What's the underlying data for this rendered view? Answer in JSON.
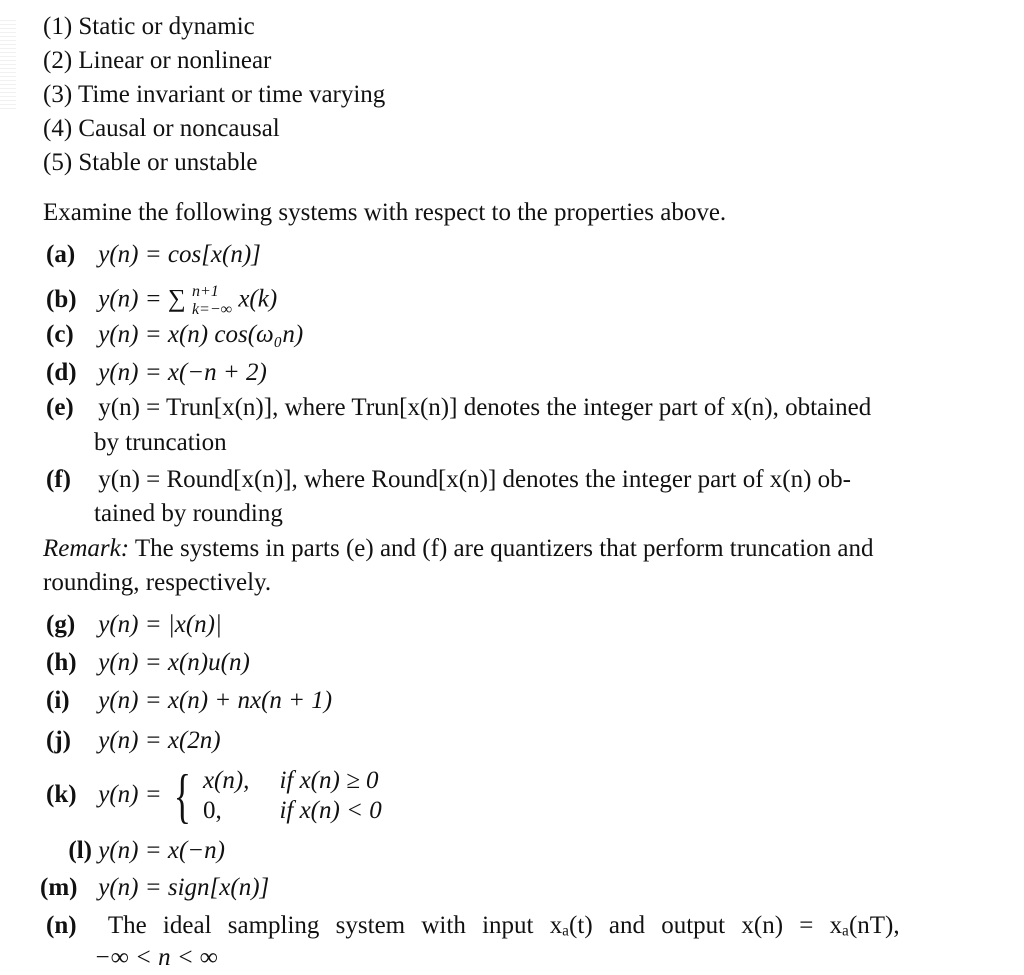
{
  "properties": [
    "(1) Static or dynamic",
    "(2) Linear or nonlinear",
    "(3) Time invariant or time varying",
    "(4) Causal or noncausal",
    "(5) Stable or unstable"
  ],
  "intro": "Examine the following systems with respect to the properties above.",
  "items": {
    "a": {
      "label": "(a)",
      "expr": "y(n) = cos[x(n)]"
    },
    "b": {
      "label": "(b)",
      "lhs": "y(n) = ",
      "sum": "∑",
      "upper": "n+1",
      "lower": "k=−∞",
      "rhs": " x(k)"
    },
    "c": {
      "label": "(c)",
      "expr": "y(n) = x(n) cos(ω₀n)"
    },
    "d": {
      "label": "(d)",
      "expr": "y(n) = x(−n + 2)"
    },
    "e": {
      "label": "(e)",
      "line1": "y(n) = Trun[x(n)], where Trun[x(n)] denotes the integer part of x(n), obtained",
      "line2": "by truncation"
    },
    "f": {
      "label": "(f)",
      "line1": "y(n) = Round[x(n)], where Round[x(n)] denotes the integer part of x(n) ob-",
      "line2": "tained by rounding"
    },
    "g": {
      "label": "(g)",
      "expr": "y(n) = |x(n)|"
    },
    "h": {
      "label": "(h)",
      "expr": "y(n) = x(n)u(n)"
    },
    "i": {
      "label": "(i)",
      "expr": "y(n) = x(n) + nx(n + 1)"
    },
    "j": {
      "label": "(j)",
      "expr": "y(n) = x(2n)"
    },
    "k": {
      "label": "(k)",
      "lhs": "y(n) = ",
      "case1_val": "x(n),",
      "case1_cond": "if x(n) ≥ 0",
      "case2_val": "0,",
      "case2_cond": "if x(n) < 0"
    },
    "l": {
      "label": "(l)",
      "expr": "y(n) = x(−n)"
    },
    "m": {
      "label": "(m)",
      "expr": "y(n) = sign[x(n)]"
    },
    "n": {
      "label": "(n)",
      "line1": "The ideal sampling system with input xₐ(t) and output x(n) = xₐ(nT),",
      "line2": "−∞ < n < ∞"
    }
  },
  "remark": {
    "label": "Remark:",
    "line1": " The systems in parts (e) and (f) are quantizers that perform truncation and",
    "line2": "rounding, respectively."
  }
}
